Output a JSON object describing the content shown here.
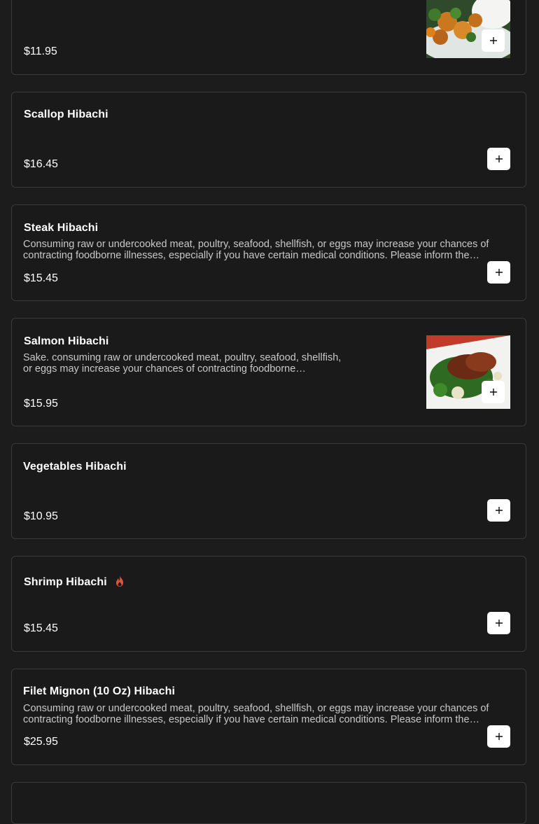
{
  "items": [
    {
      "title": "",
      "description": "",
      "price": "$11.95",
      "has_image": true,
      "image_icon": "orange-chicken-dish-photo"
    },
    {
      "title": "Scallop Hibachi",
      "description": "",
      "price": "$16.45"
    },
    {
      "title": "Steak Hibachi",
      "description": "Consuming raw or undercooked meat, poultry, seafood, shellfish, or eggs may increase your chances of contracting foodborne illnesses, especially if you have certain medical conditions. Please inform the server…",
      "price": "$15.45"
    },
    {
      "title": "Salmon Hibachi",
      "description": "Sake. consuming raw or undercooked meat, poultry, seafood, shellfish, or eggs may increase your chances of contracting foodborne illnesses,…",
      "price": "$15.95",
      "has_image": true,
      "image_icon": "salmon-dish-photo"
    },
    {
      "title": "Vegetables Hibachi",
      "description": "",
      "price": "$10.95"
    },
    {
      "title": "Shrimp Hibachi",
      "description": "",
      "price": "$15.45",
      "badge_icon": "spicy-fire-icon"
    },
    {
      "title": "Filet Mignon (10 Oz) Hibachi",
      "description": "Consuming raw or undercooked meat, poultry, seafood, shellfish, or eggs may increase your chances of contracting foodborne illnesses, especially if you have certain medical conditions. Please inform the server…",
      "price": "$25.95"
    },
    {
      "title": "",
      "description": "",
      "price": ""
    }
  ],
  "colors": {
    "background": "#1c1c1c",
    "card_border": "#3a3a3a",
    "button_bg": "#ffffff",
    "spicy": "#e0533a"
  }
}
